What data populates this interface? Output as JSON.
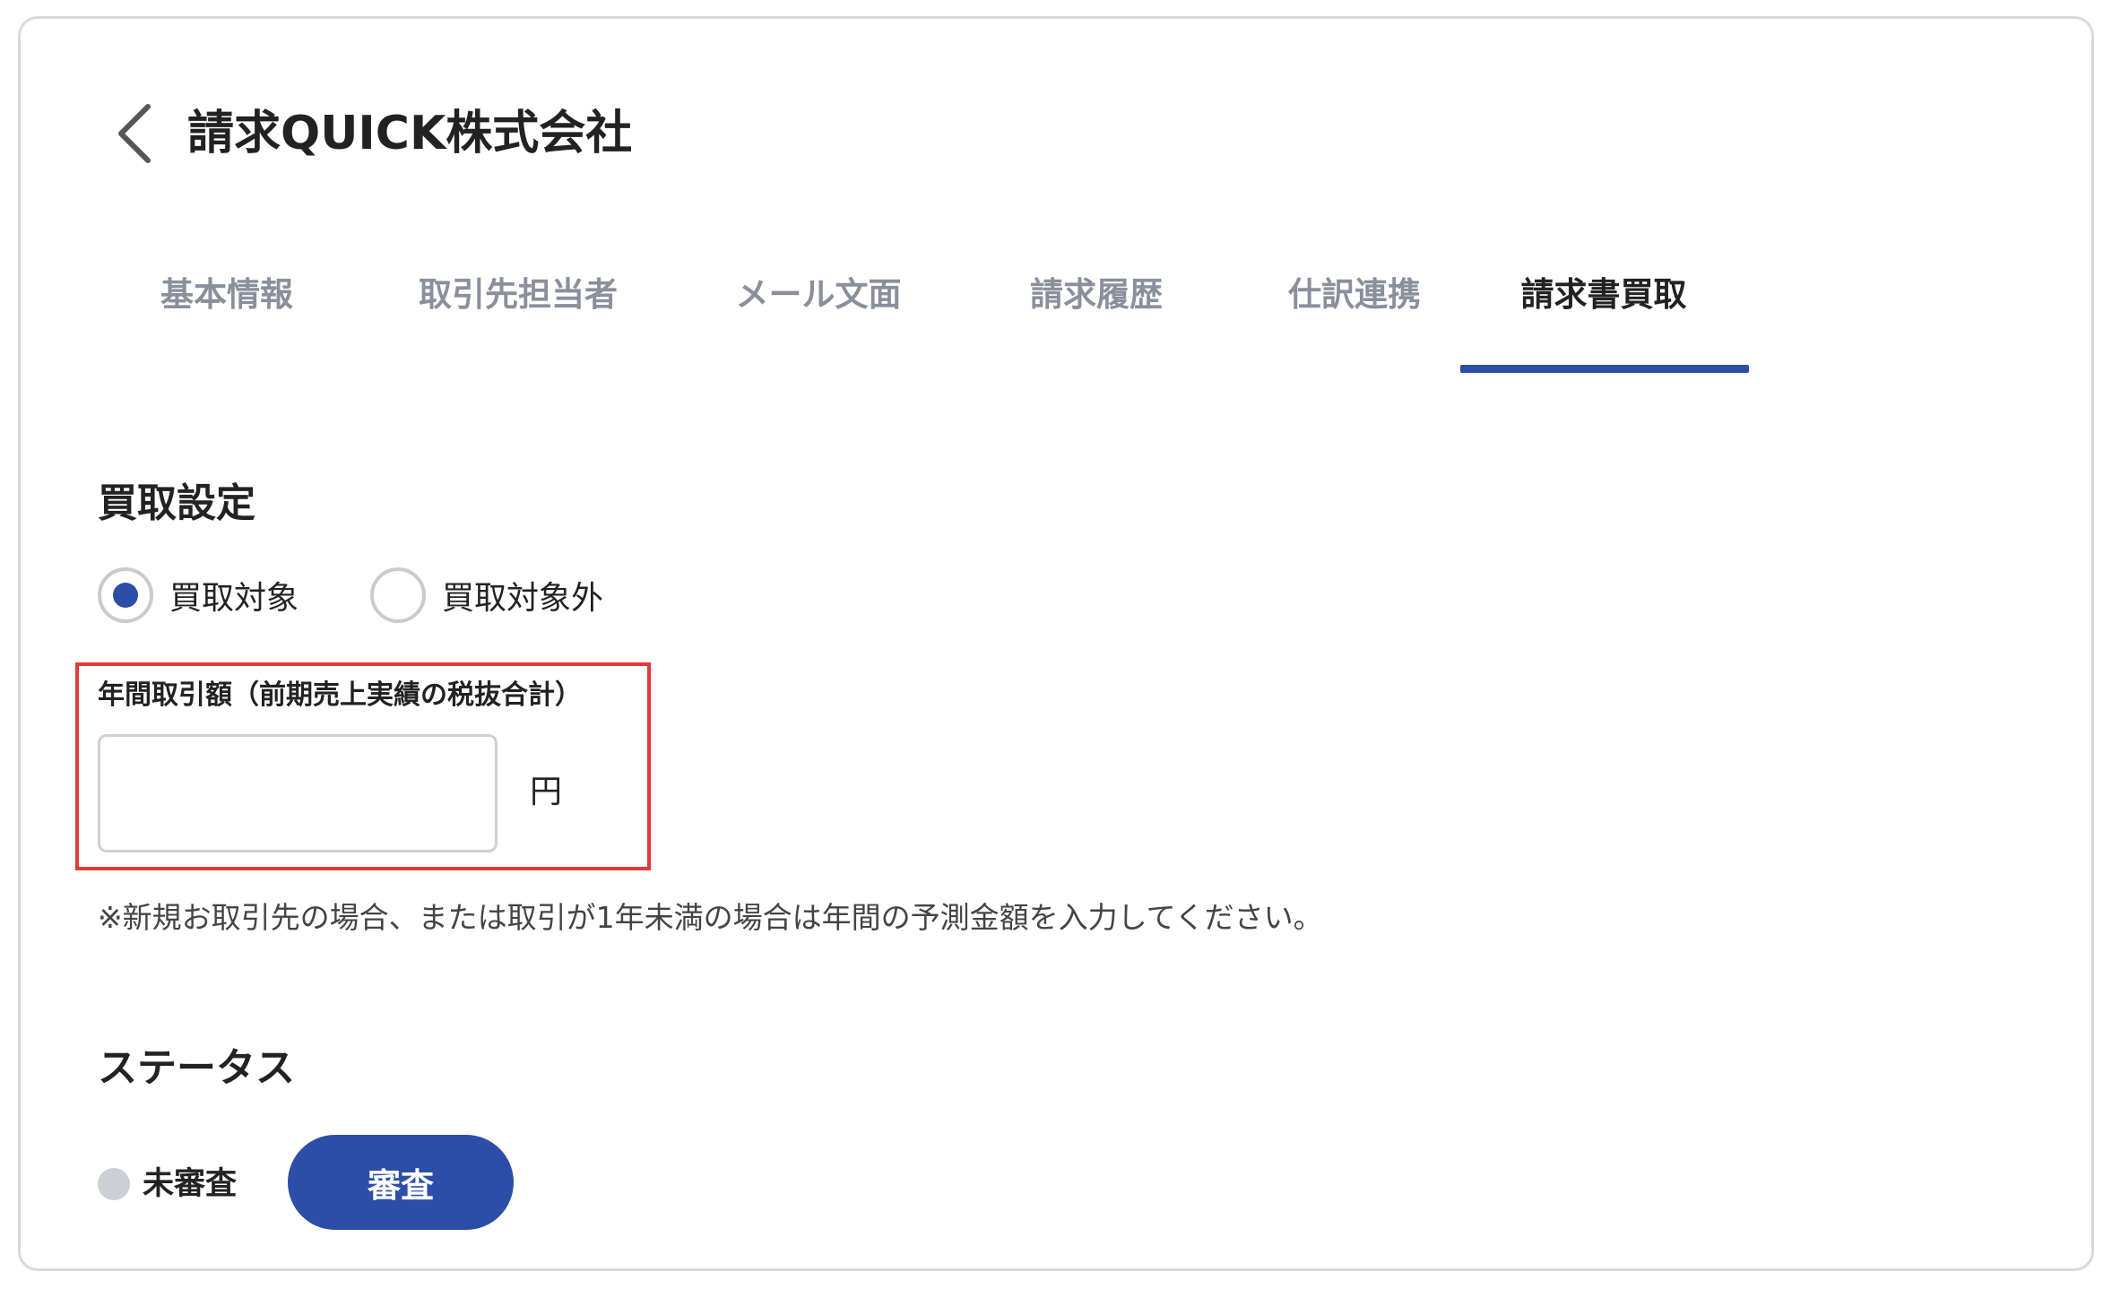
{
  "header": {
    "title": "請求QUICK株式会社"
  },
  "tabs": [
    {
      "label": "基本情報"
    },
    {
      "label": "取引先担当者"
    },
    {
      "label": "メール文面"
    },
    {
      "label": "請求履歴"
    },
    {
      "label": "仕訳連携"
    },
    {
      "label": "請求書買取",
      "active": true
    }
  ],
  "purchase_settings": {
    "heading": "買取設定",
    "options": [
      {
        "label": "買取対象",
        "selected": true
      },
      {
        "label": "買取対象外",
        "selected": false
      }
    ]
  },
  "annual_amount": {
    "label": "年間取引額（前期売上実績の税抜合計）",
    "value": "",
    "unit": "円",
    "note": "※新規お取引先の場合、または取引が1年未満の場合は年間の予測金額を入力してください。"
  },
  "status": {
    "heading": "ステータス",
    "current": "未審査",
    "button_label": "審査"
  },
  "colors": {
    "accent": "#2c4ea6",
    "highlight": "#e23a3a",
    "muted_tab": "#8a8f9c"
  }
}
